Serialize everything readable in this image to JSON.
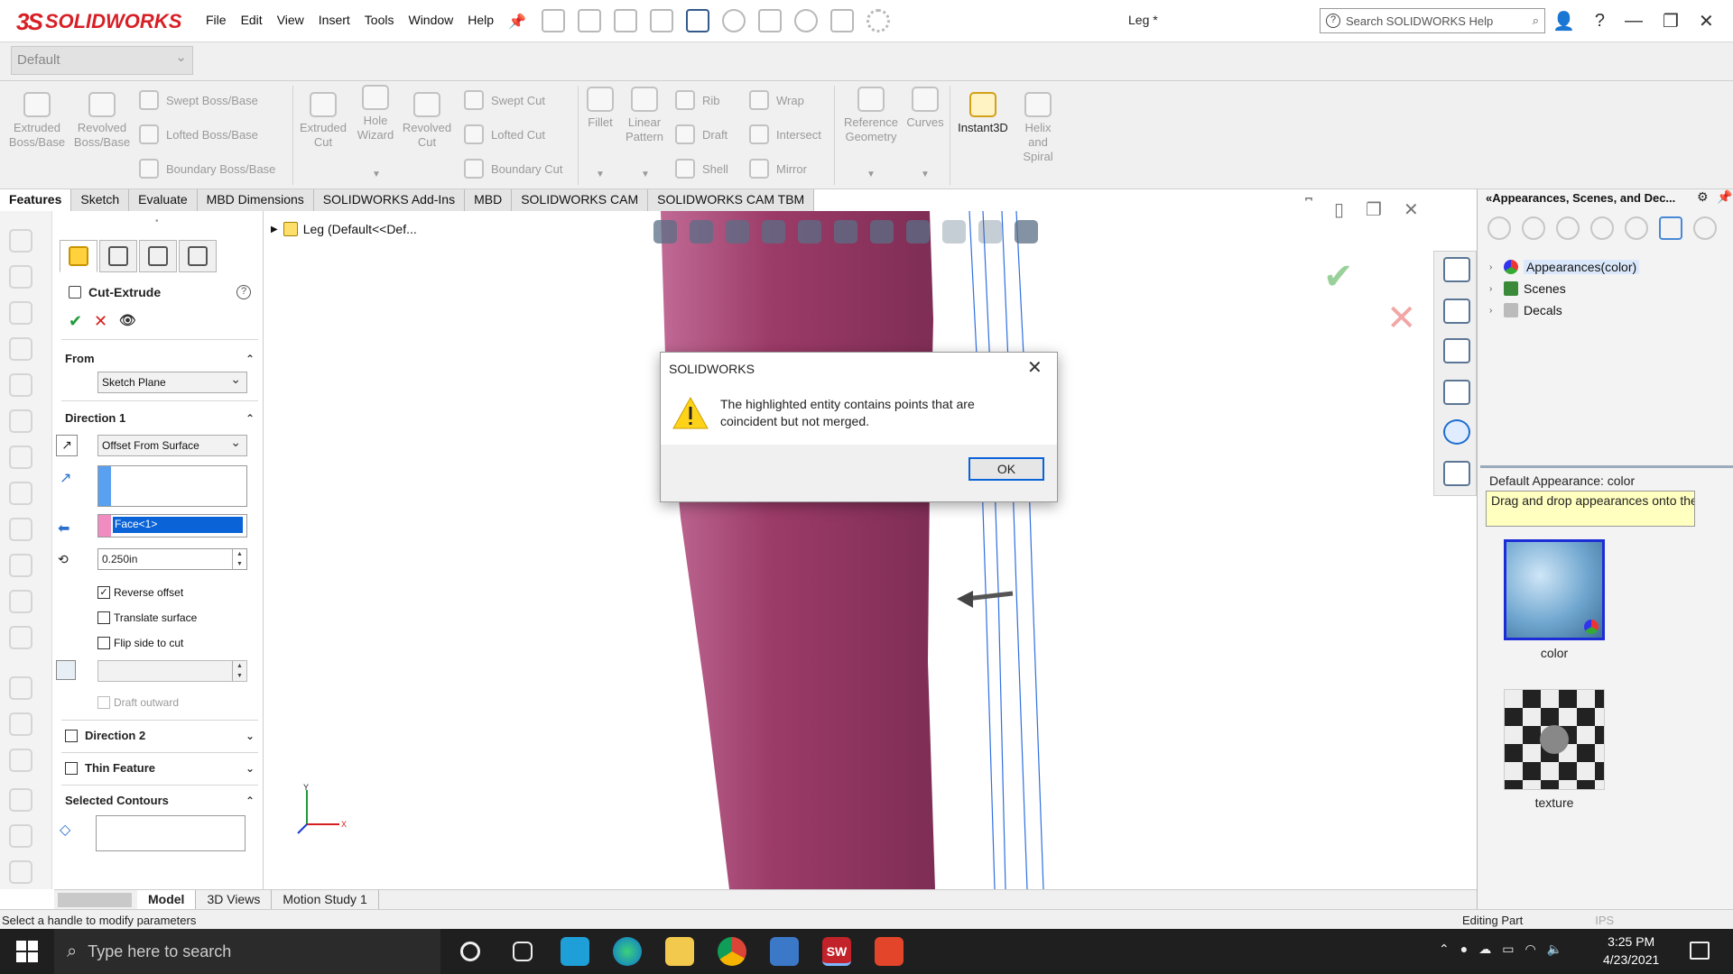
{
  "app": {
    "brand": "SOLIDWORKS",
    "brand_mark": "3S",
    "doc_title": "Leg *",
    "menu": [
      "File",
      "Edit",
      "View",
      "Insert",
      "Tools",
      "Window",
      "Help"
    ],
    "search_placeholder": "Search SOLIDWORKS Help",
    "configuration": "Default"
  },
  "commands": {
    "extruded_boss": "Extruded Boss/Base",
    "revolved_boss": "Revolved Boss/Base",
    "swept_boss": "Swept Boss/Base",
    "lofted_boss": "Lofted Boss/Base",
    "boundary_boss": "Boundary Boss/Base",
    "extruded_cut": "Extruded Cut",
    "hole_wizard": "Hole Wizard",
    "revolved_cut": "Revolved Cut",
    "swept_cut": "Swept Cut",
    "lofted_cut": "Lofted Cut",
    "boundary_cut": "Boundary Cut",
    "fillet": "Fillet",
    "linear_pattern": "Linear Pattern",
    "rib": "Rib",
    "draft": "Draft",
    "shell": "Shell",
    "wrap": "Wrap",
    "intersect": "Intersect",
    "mirror": "Mirror",
    "reference_geometry": "Reference Geometry",
    "curves": "Curves",
    "instant3d": "Instant3D",
    "helix": "Helix and Spiral"
  },
  "tabs": [
    "Features",
    "Sketch",
    "Evaluate",
    "MBD Dimensions",
    "SOLIDWORKS Add-Ins",
    "MBD",
    "SOLIDWORKS CAM",
    "SOLIDWORKS CAM TBM"
  ],
  "property_manager": {
    "title": "Cut-Extrude",
    "help": "?",
    "from_label": "From",
    "from_value": "Sketch Plane",
    "direction1_label": "Direction 1",
    "end_condition": "Offset From Surface",
    "face_selection": "Face<1>",
    "offset_value": "0.250in",
    "reverse_offset": "Reverse offset",
    "translate_surface": "Translate surface",
    "flip_side": "Flip side to cut",
    "draft_outward": "Draft outward",
    "direction2_label": "Direction 2",
    "thin_feature_label": "Thin Feature",
    "selected_contours_label": "Selected Contours"
  },
  "viewport": {
    "tree_item": "Leg  (Default<<Def...",
    "triad_x": "X",
    "triad_y": "Y"
  },
  "view_tabs": [
    "Model",
    "3D Views",
    "Motion Study 1"
  ],
  "status": {
    "message": "Select a handle to modify parameters",
    "mode": "Editing Part",
    "units": "IPS"
  },
  "task_pane": {
    "title": "Appearances, Scenes, and Dec...",
    "tree": [
      "Appearances(color)",
      "Scenes",
      "Decals"
    ],
    "default_appearance": "Default Appearance: color",
    "tooltip": "Drag and drop appearances onto the ...",
    "thumbs": [
      "color",
      "texture"
    ]
  },
  "dialog": {
    "title": "SOLIDWORKS",
    "message": "The highlighted entity contains points that are coincident but not merged.",
    "ok": "OK"
  },
  "taskbar": {
    "search_placeholder": "Type here to search",
    "time": "3:25 PM",
    "date": "4/23/2021"
  },
  "colors": {
    "brand": "#d71f26",
    "body": "#a3436f",
    "sketch_lines": "#2f6fe0",
    "selection_pink": "#f08cc0",
    "selection_blue": "#5aa0f0"
  }
}
